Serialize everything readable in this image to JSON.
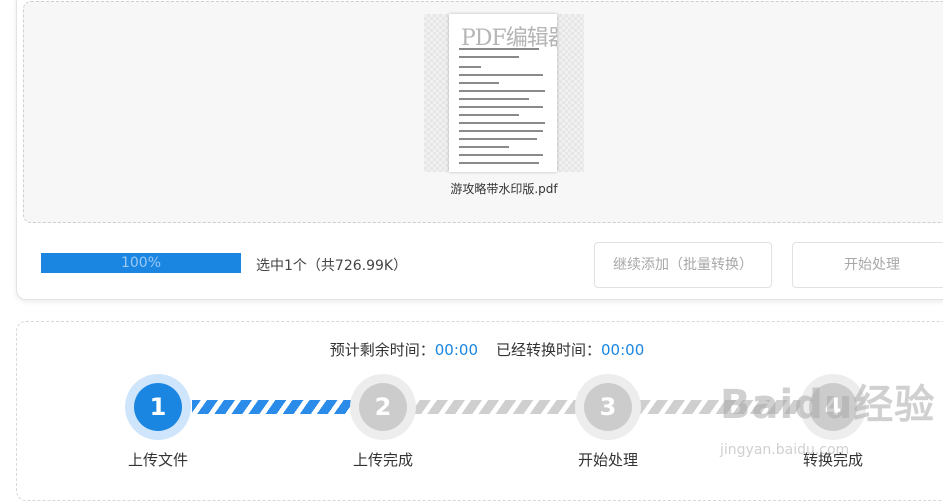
{
  "upload": {
    "thumbnail_watermark": "PDF编辑器",
    "file_name": "游攻略带水印版.pdf",
    "progress_percent": 100,
    "progress_text": "100%",
    "selected_info": "选中1个（共726.99K）",
    "add_more_label": "继续添加（批量转换）",
    "start_label": "开始处理"
  },
  "status": {
    "remaining_label": "预计剩余时间：",
    "remaining_value": "00:00",
    "elapsed_label": "已经转换时间：",
    "elapsed_value": "00:00"
  },
  "steps": [
    {
      "number": "1",
      "label": "上传文件",
      "state": "active"
    },
    {
      "number": "2",
      "label": "上传完成",
      "state": "idle"
    },
    {
      "number": "3",
      "label": "开始处理",
      "state": "idle"
    },
    {
      "number": "4",
      "label": "转换完成",
      "state": "idle"
    }
  ],
  "watermark": {
    "logo": "Baidu经验",
    "sub": "jingyan.baidu.com"
  },
  "colors": {
    "accent": "#1a86e2",
    "idle": "#cccccc"
  }
}
